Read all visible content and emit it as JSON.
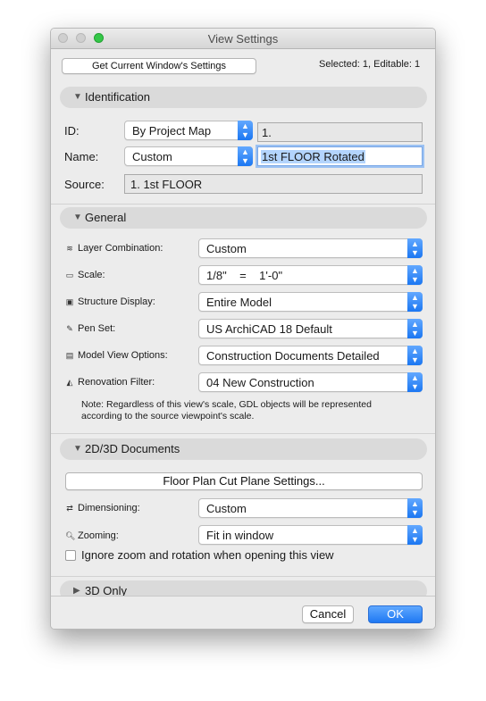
{
  "window": {
    "title": "View Settings"
  },
  "top": {
    "get_settings_label": "Get Current Window's Settings",
    "selection_status": "Selected: 1, Editable: 1"
  },
  "identification": {
    "header": "Identification",
    "id_label": "ID:",
    "id_mode": "By Project Map",
    "id_value": "1.",
    "name_label": "Name:",
    "name_mode": "Custom",
    "name_value": "1st FLOOR Rotated",
    "source_label": "Source:",
    "source_value": "1. 1st FLOOR"
  },
  "general": {
    "header": "General",
    "rows": [
      {
        "icon": "layer-combination-icon",
        "label": "Layer Combination:",
        "value": "Custom"
      },
      {
        "icon": "scale-icon",
        "label": "Scale:",
        "value": "1/8\"    =    1'-0\""
      },
      {
        "icon": "structure-display-icon",
        "label": "Structure Display:",
        "value": "Entire Model"
      },
      {
        "icon": "pen-set-icon",
        "label": "Pen Set:",
        "value": "US ArchiCAD 18 Default"
      },
      {
        "icon": "model-view-options-icon",
        "label": "Model View Options:",
        "value": "Construction Documents Detailed"
      },
      {
        "icon": "renovation-filter-icon",
        "label": "Renovation Filter:",
        "value": "04 New Construction"
      }
    ],
    "note_line1": "Note: Regardless of this view's scale, GDL objects will be represented",
    "note_line2": "according to the source viewpoint's scale."
  },
  "documents": {
    "header": "2D/3D Documents",
    "cut_plane_label": "Floor Plan Cut Plane Settings...",
    "dimensioning_label": "Dimensioning:",
    "dimensioning_value": "Custom",
    "zooming_label": "Zooming:",
    "zooming_value": "Fit in window",
    "ignore_zoom_label": "Ignore zoom and rotation when opening this view",
    "ignore_zoom_checked": false
  },
  "only3d": {
    "header": "3D Only"
  },
  "buttons": {
    "cancel": "Cancel",
    "ok": "OK"
  },
  "colors": {
    "accent": "#1f78f3",
    "section_bg": "#dadada",
    "window_bg": "#ececec"
  }
}
